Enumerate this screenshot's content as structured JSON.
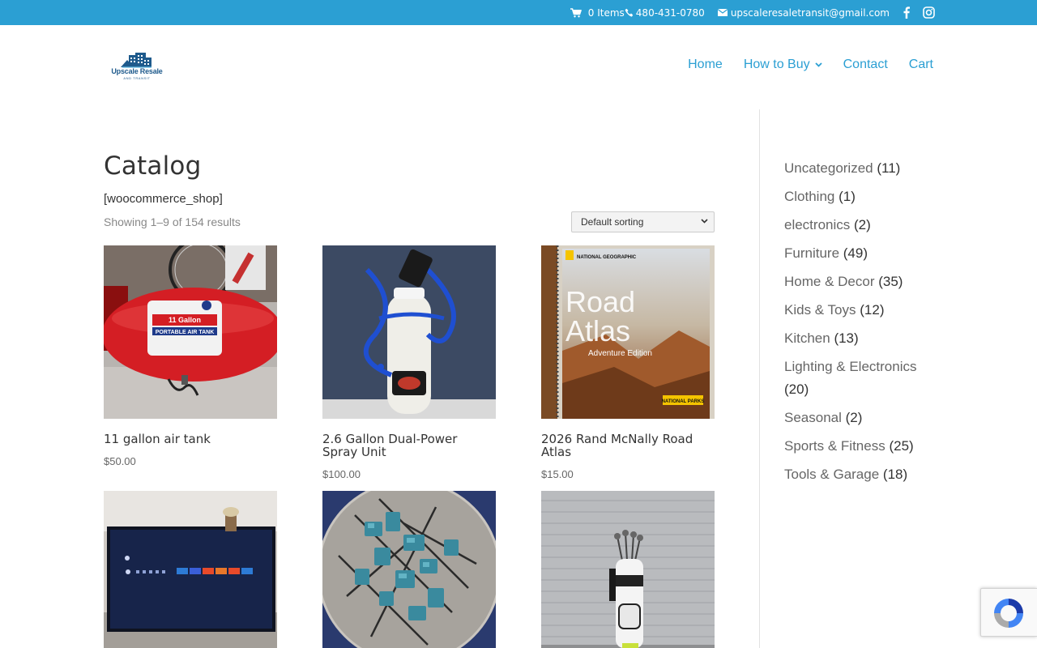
{
  "topbar": {
    "cart_label": "0 Items",
    "phone": "480-431-0780",
    "email": "upscaleresaletransit@gmail.com",
    "icons": [
      "cart-icon",
      "phone-icon",
      "envelope-icon",
      "facebook-icon",
      "instagram-icon"
    ]
  },
  "logo": {
    "name": "Upscale Resale",
    "tagline": "AND TRANSIT"
  },
  "nav": {
    "items": [
      {
        "label": "Home"
      },
      {
        "label": "How to Buy"
      },
      {
        "label": "Contact"
      },
      {
        "label": "Cart"
      }
    ]
  },
  "main": {
    "title": "Catalog",
    "shortcode": "[woocommerce_shop]",
    "result_count": "Showing 1–9 of 154 results",
    "sorting": "Default sorting",
    "products": [
      {
        "name": "11 gallon air tank",
        "price": "$50.00"
      },
      {
        "name": "2.6 Gallon Dual-Power Spray Unit",
        "price": "$100.00"
      },
      {
        "name": "2026 Rand McNally Road Atlas",
        "price": "$15.00"
      },
      {
        "name": "",
        "price": ""
      },
      {
        "name": "",
        "price": ""
      },
      {
        "name": "",
        "price": ""
      }
    ],
    "atlas_cover": {
      "brand": "NATIONAL GEOGRAPHIC",
      "title_line1": "Road",
      "title_line2": "Atlas",
      "subtitle": "Adventure Edition",
      "footer": "NATIONAL PARKS"
    },
    "tank_label": {
      "line1": "11 Gallon",
      "line2": "PORTABLE AIR TANK"
    }
  },
  "sidebar": {
    "categories": [
      {
        "label": "Uncategorized",
        "count": "(11)"
      },
      {
        "label": "Clothing",
        "count": "(1)"
      },
      {
        "label": "electronics",
        "count": "(2)"
      },
      {
        "label": "Furniture",
        "count": "(49)"
      },
      {
        "label": "Home & Decor",
        "count": "(35)"
      },
      {
        "label": "Kids & Toys",
        "count": "(12)"
      },
      {
        "label": "Kitchen",
        "count": "(13)"
      },
      {
        "label": "Lighting & Electronics",
        "count": "(20)"
      },
      {
        "label": "Seasonal",
        "count": "(2)"
      },
      {
        "label": "Sports & Fitness",
        "count": "(25)"
      },
      {
        "label": "Tools & Garage",
        "count": "(18)"
      }
    ]
  },
  "colors": {
    "accent": "#2b9fd3",
    "heading": "#333333",
    "body": "#666666"
  }
}
